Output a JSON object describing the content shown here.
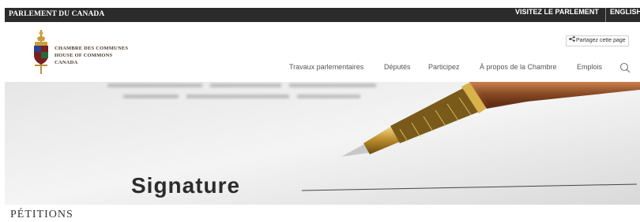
{
  "topbar": {
    "brand": "PARLEMENT DU CANADA",
    "visit": "VISITEZ LE PARLEMENT",
    "english": "ENGLISH"
  },
  "logo": {
    "line1": "CHAMBRE DES COMMUNES",
    "line2": "HOUSE OF COMMONS",
    "line3": "CANADA"
  },
  "share": {
    "label": "Partagez cette page",
    "icon": "share-icon"
  },
  "nav": {
    "items": [
      "Travaux parlementaires",
      "Députés",
      "Participez",
      "À propos de la Chambre",
      "Emplois"
    ],
    "search_icon": "search-icon"
  },
  "hero": {
    "word": "Signature"
  },
  "page_title": "PÉTITIONS",
  "colors": {
    "topbar": "#2b2b2b",
    "nav_text": "#555555",
    "logo_text": "#4a3a2a"
  }
}
